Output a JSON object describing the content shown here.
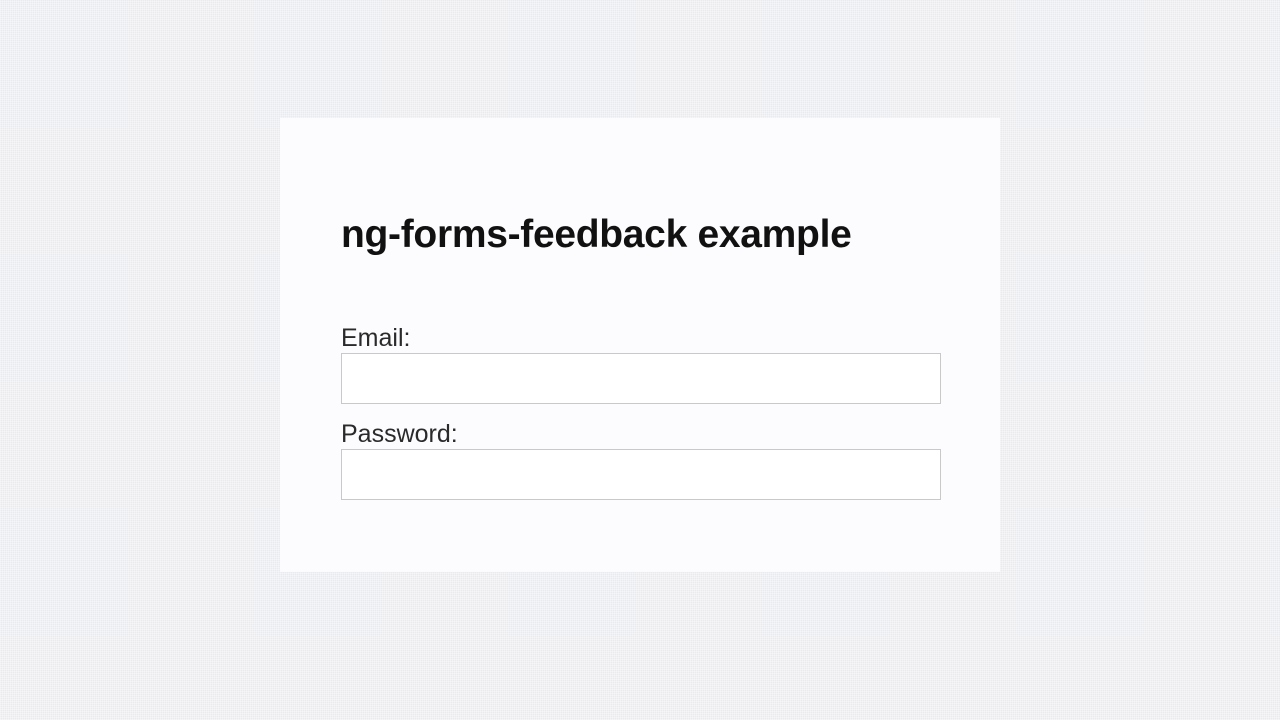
{
  "page": {
    "title": "ng-forms-feedback example"
  },
  "form": {
    "email": {
      "label": "Email:",
      "value": "",
      "placeholder": ""
    },
    "password": {
      "label": "Password:",
      "value": "",
      "placeholder": ""
    }
  }
}
